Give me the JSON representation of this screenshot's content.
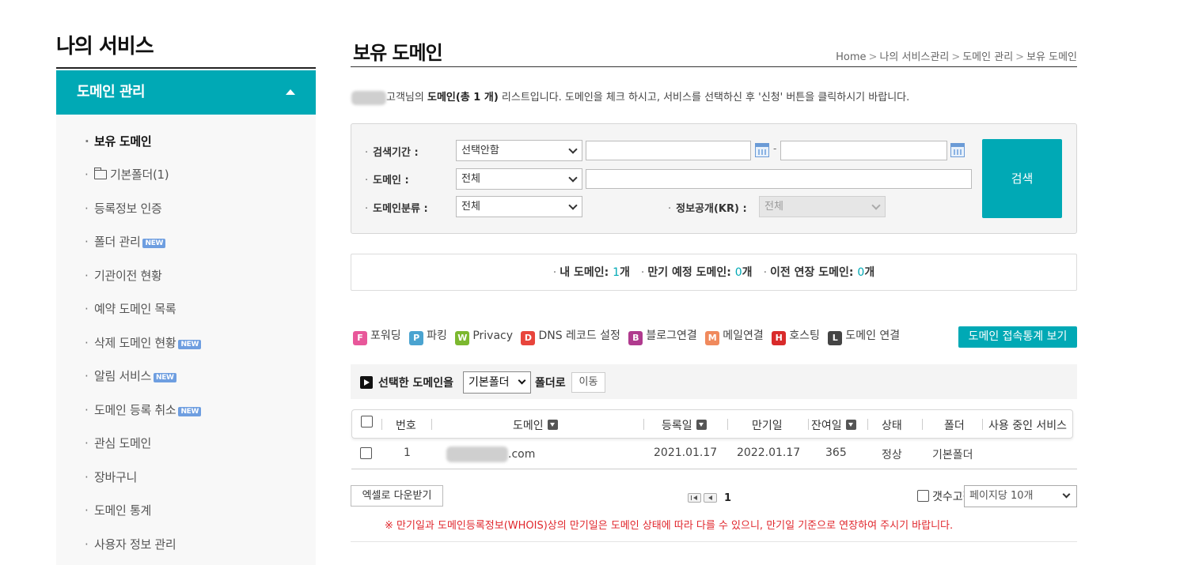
{
  "sidebar": {
    "title": "나의 서비스",
    "section_header": "도메인 관리",
    "items": [
      {
        "label": "보유 도메인",
        "new": false,
        "active": true
      },
      {
        "label": "기본폴더(1)",
        "new": false,
        "folder": true
      },
      {
        "label": "등록정보 인증",
        "new": false
      },
      {
        "label": "폴더 관리",
        "new": true
      },
      {
        "label": "기관이전 현황",
        "new": false
      },
      {
        "label": "예약 도메인 목록",
        "new": false
      },
      {
        "label": "삭제 도메인 현황",
        "new": true
      },
      {
        "label": "알림 서비스",
        "new": true
      },
      {
        "label": "도메인 등록 취소",
        "new": true
      },
      {
        "label": "관심 도메인",
        "new": false
      },
      {
        "label": "장바구니",
        "new": false
      },
      {
        "label": "도메인 통계",
        "new": false
      },
      {
        "label": "사용자 정보 관리",
        "new": false
      }
    ],
    "new_badge": "NEW"
  },
  "page": {
    "title": "보유 도메인",
    "breadcrumb": [
      "Home",
      "나의 서비스관리",
      "도메인 관리",
      "보유 도메인"
    ],
    "intro_prefix": "고객님의 ",
    "intro_bold": "도메인(총 1 개)",
    "intro_suffix": " 리스트입니다. 도메인을 체크 하시고, 서비스를 선택하신 후 '신청' 버튼을 클릭하시기 바랍니다."
  },
  "search": {
    "period_label": "검색기간 :",
    "period_select": "선택안함",
    "date_separator": "-",
    "domain_label": "도메인 :",
    "domain_select": "전체",
    "category_label": "도메인분류 :",
    "category_select": "전체",
    "public_label": "정보공개(KR) :",
    "public_select": "전체",
    "button": "검색"
  },
  "summary": {
    "my_domains_label": "내 도메인:",
    "my_domains_count": "1",
    "expiring_label": "만기 예정 도메인:",
    "expiring_count": "0",
    "transfer_label": "이전 연장 도메인:",
    "transfer_count": "0",
    "unit": "개"
  },
  "legend": [
    {
      "letter": "F",
      "label": "포워딩",
      "color": "#e8579a"
    },
    {
      "letter": "P",
      "label": "파킹",
      "color": "#4aa3d0"
    },
    {
      "letter": "W",
      "label": "Privacy",
      "color": "#7cb82f"
    },
    {
      "letter": "D",
      "label": "DNS 레코드 설정",
      "color": "#e8453c"
    },
    {
      "letter": "B",
      "label": "블로그연결",
      "color": "#b03a8e"
    },
    {
      "letter": "M",
      "label": "메일연결",
      "color": "#f08a5d"
    },
    {
      "letter": "H",
      "label": "호스팅",
      "color": "#d92b2b"
    },
    {
      "letter": "L",
      "label": "도메인 연결",
      "color": "#444444"
    }
  ],
  "stats_button": "도메인 접속통계 보기",
  "move": {
    "prefix": "선택한 도메인을",
    "folder_select": "기본폴더",
    "suffix": "폴더로",
    "button": "이동"
  },
  "table": {
    "headers": {
      "no": "번호",
      "domain": "도메인",
      "reg_date": "등록일",
      "exp_date": "만기일",
      "remaining": "잔여일",
      "status": "상태",
      "folder": "폴더",
      "services": "사용 중인 서비스"
    },
    "rows": [
      {
        "no": "1",
        "domain_suffix": ".com",
        "reg_date": "2021.01.17",
        "exp_date": "2022.01.17",
        "remaining": "365",
        "status": "정상",
        "folder": "기본폴더"
      }
    ]
  },
  "footer": {
    "excel_button": "엑셀로 다운받기",
    "page_number": "1",
    "fix_count_label": "갯수고정",
    "per_page_select": "페이지당 10개",
    "notice": "※ 만기일과 도메인등록정보(WHOIS)상의 만기일은 도메인 상태에 따라 다를 수 있으니, 만기일 기준으로 연장하여 주시기 바랍니다."
  },
  "colors": {
    "accent": "#00a9b5",
    "notice": "#e0262c"
  }
}
